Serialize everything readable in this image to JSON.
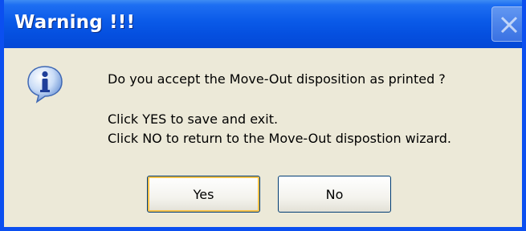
{
  "dialog": {
    "title": "Warning !!!",
    "icon": "information-icon",
    "message_lines": [
      "Do you accept the Move-Out disposition as printed ?",
      "Click YES to save and exit.",
      "Click NO to return to the Move-Out dispostion wizard."
    ],
    "buttons": {
      "yes_label": "Yes",
      "no_label": "No"
    }
  },
  "colors": {
    "titlebar": "#0550e0",
    "window_body": "#ece9d8",
    "button_border": "#003c74"
  }
}
